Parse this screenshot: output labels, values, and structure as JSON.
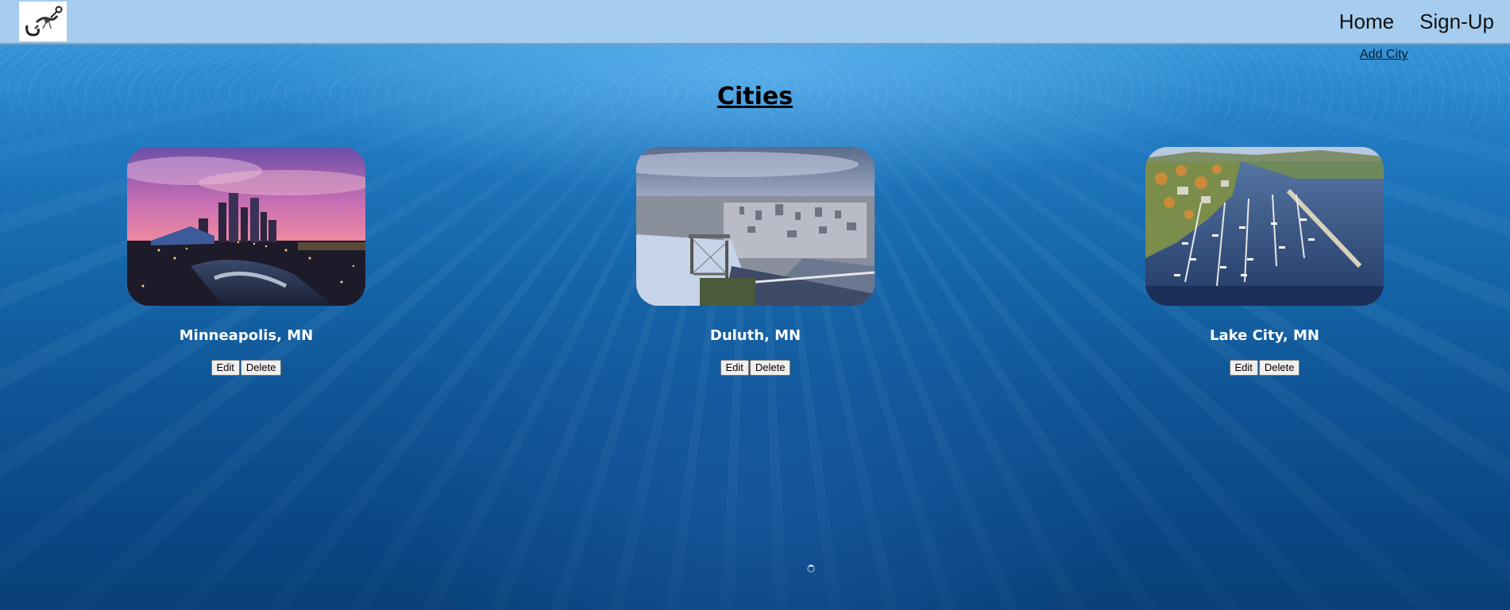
{
  "nav": {
    "home_label": "Home",
    "signup_label": "Sign-Up",
    "logo_icon": "fish-hook-logo-icon"
  },
  "actions": {
    "add_city_label": "Add City"
  },
  "page": {
    "title": "Cities"
  },
  "cities": [
    {
      "name": "Minneapolis, MN",
      "edit_label": "Edit",
      "delete_label": "Delete",
      "image": "minneapolis-skyline-photo"
    },
    {
      "name": "Duluth, MN",
      "edit_label": "Edit",
      "delete_label": "Delete",
      "image": "duluth-aerial-bridge-photo"
    },
    {
      "name": "Lake City, MN",
      "edit_label": "Edit",
      "delete_label": "Delete",
      "image": "lake-city-marina-photo"
    }
  ],
  "colors": {
    "navbar_bg": "#a6cdee",
    "water_top": "#3d9fe0",
    "water_bottom": "#0a3f78",
    "city_name_text": "#ffffff"
  }
}
